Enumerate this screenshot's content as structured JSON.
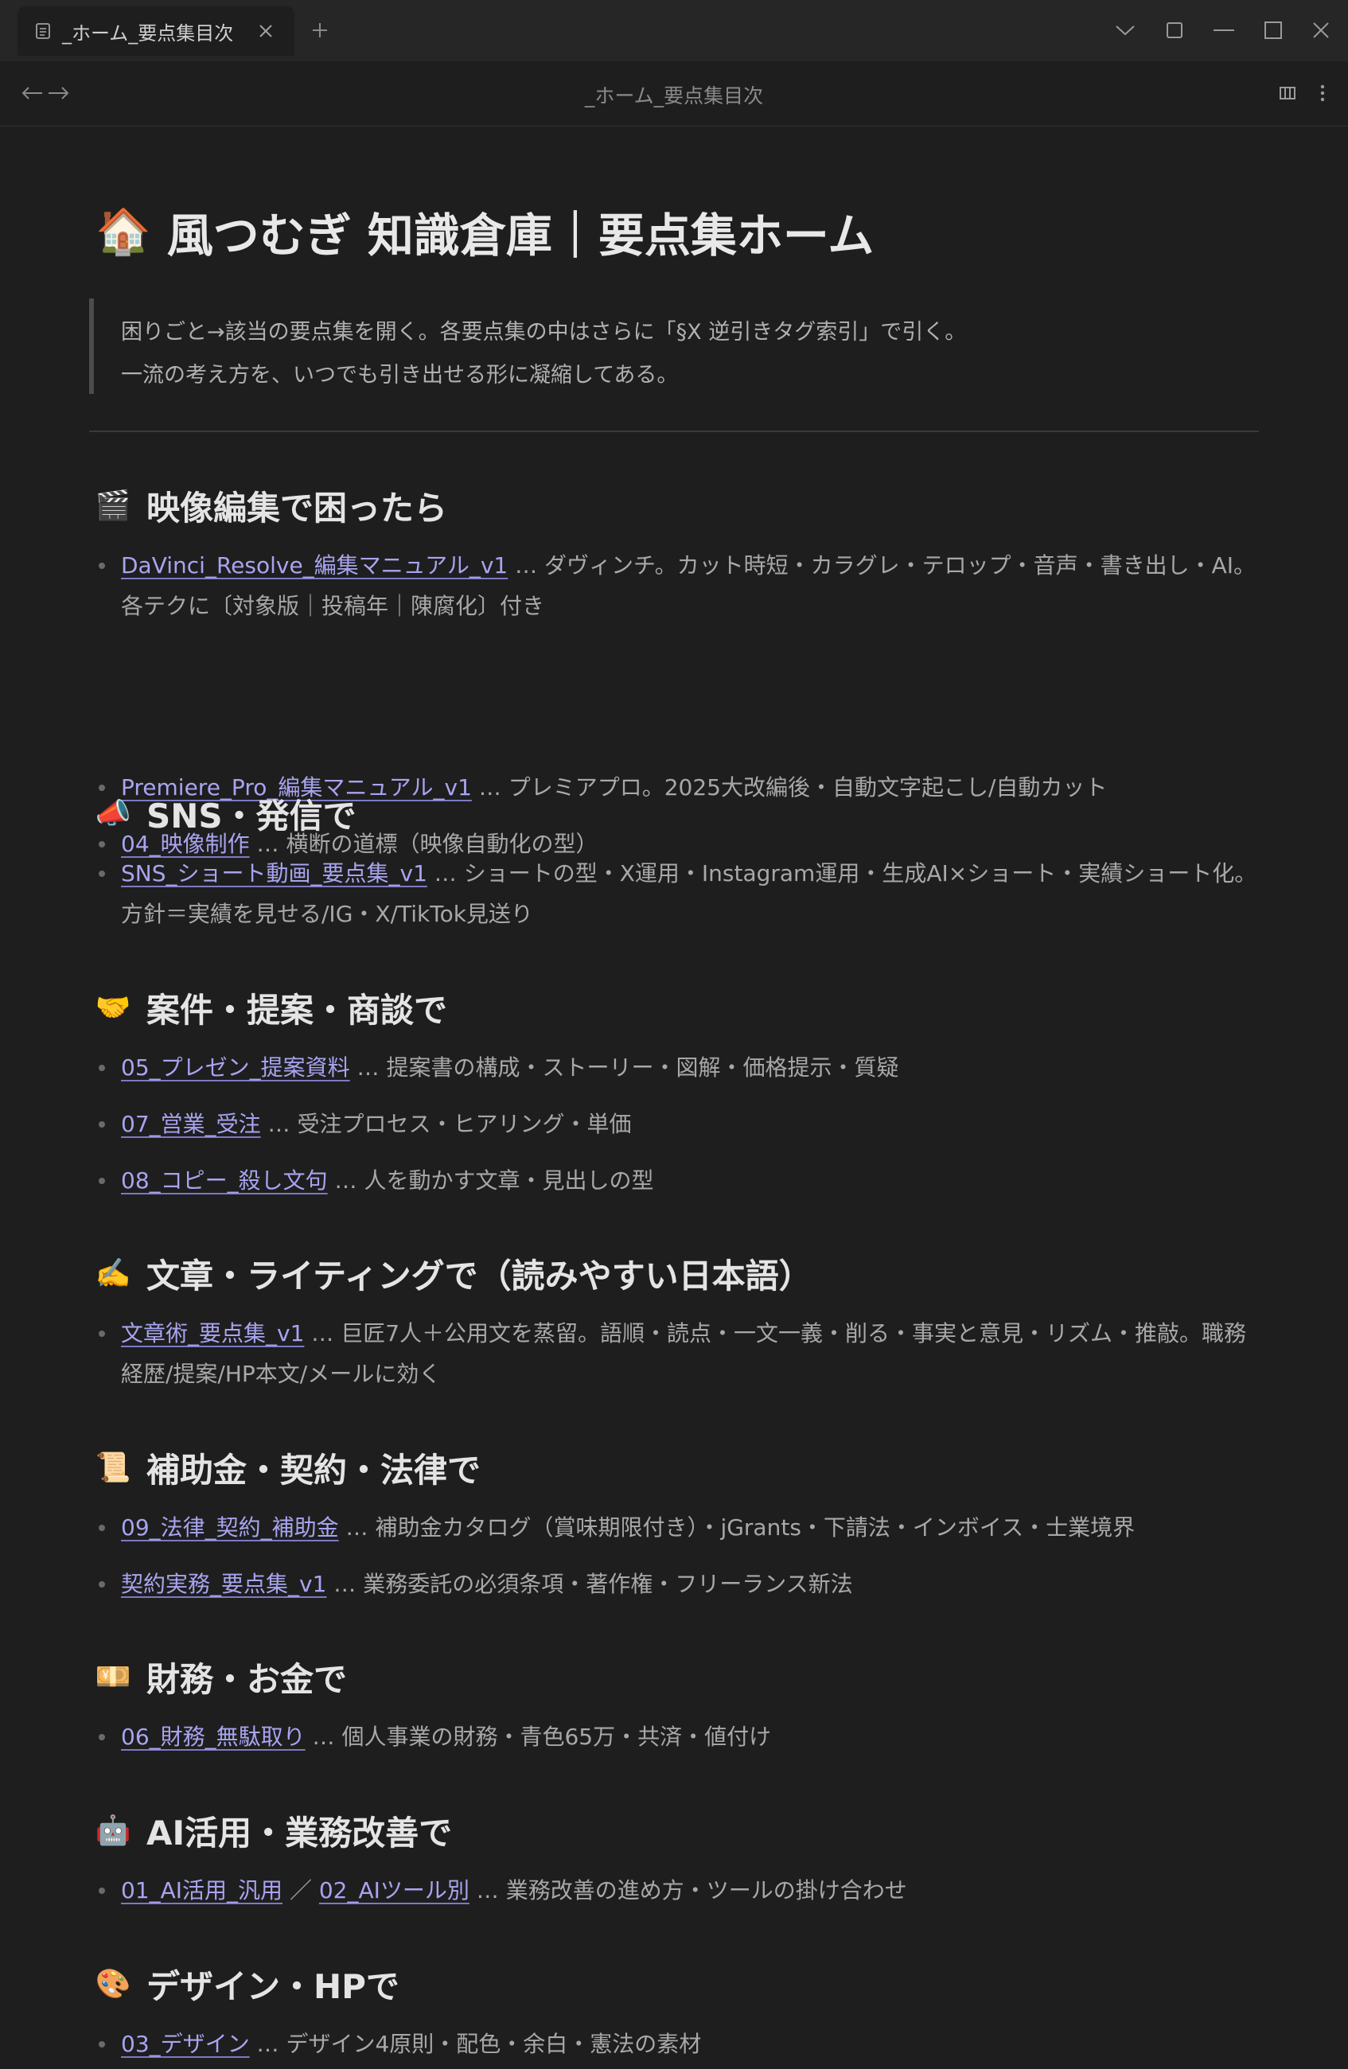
{
  "tab": {
    "title": "_ホーム_要点集目次",
    "icon": "document-icon"
  },
  "header": {
    "title": "_ホーム_要点集目次"
  },
  "page": {
    "title_emoji": "🏠",
    "title": "風つむぎ 知識倉庫｜要点集ホーム",
    "quote_line1": "困りごと→該当の要点集を開く。各要点集の中はさらに「§X 逆引きタグ索引」で引く。",
    "quote_line2": "一流の考え方を、いつでも引き出せる形に凝縮してある。"
  },
  "sections": [
    {
      "emoji": "🎬",
      "heading": "映像編集で困ったら",
      "items": [
        {
          "link": "DaVinci_Resolve_編集マニュアル_v1",
          "desc": " … ダヴィンチ。カット時短・カラグレ・テロップ・音声・書き出し・AI。各テクに〔対象版｜投稿年｜陳腐化〕付き"
        },
        {
          "link": "Premiere_Pro_編集マニュアル_v1",
          "desc": " … プレミアプロ。2025大改編後・自動文字起こし/自動カット"
        },
        {
          "link": "04_映像制作",
          "desc": " … 横断の道標（映像自動化の型）"
        }
      ]
    },
    {
      "emoji": "📣",
      "heading": "SNS・発信で",
      "items": [
        {
          "link": "SNS_ショート動画_要点集_v1",
          "desc": " … ショートの型・X運用・Instagram運用・生成AI×ショート・実績ショート化。方針＝実績を見せる/IG・X/TikTok見送り"
        }
      ]
    },
    {
      "emoji": "🤝",
      "heading": "案件・提案・商談で",
      "items": [
        {
          "link": "05_プレゼン_提案資料",
          "desc": " … 提案書の構成・ストーリー・図解・価格提示・質疑"
        },
        {
          "link": "07_営業_受注",
          "desc": " … 受注プロセス・ヒアリング・単価"
        },
        {
          "link": "08_コピー_殺し文句",
          "desc": " … 人を動かす文章・見出しの型"
        }
      ]
    },
    {
      "emoji": "✍️",
      "heading": "文章・ライティングで（読みやすい日本語）",
      "items": [
        {
          "link": "文章術_要点集_v1",
          "desc": " … 巨匠7人＋公用文を蒸留。語順・読点・一文一義・削る・事実と意見・リズム・推敲。職務経歴/提案/HP本文/メールに効く"
        }
      ]
    },
    {
      "emoji": "📜",
      "heading": "補助金・契約・法律で",
      "items": [
        {
          "link": "09_法律_契約_補助金",
          "desc": " … 補助金カタログ（賞味期限付き）・jGrants・下請法・インボイス・士業境界"
        },
        {
          "link": "契約実務_要点集_v1",
          "desc": " … 業務委託の必須条項・著作権・フリーランス新法"
        }
      ]
    },
    {
      "emoji": "💴",
      "heading": "財務・お金で",
      "items": [
        {
          "link": "06_財務_無駄取り",
          "desc": " … 個人事業の財務・青色65万・共済・値付け"
        }
      ]
    },
    {
      "emoji": "🤖",
      "heading": "AI活用・業務改善で",
      "items": [
        {
          "link": "01_AI活用_汎用",
          "sep": " ／ ",
          "link2": "02_AIツール別",
          "desc": " … 業務改善の進め方・ツールの掛け合わせ"
        }
      ]
    },
    {
      "emoji": "🎨",
      "heading": "デザイン・HPで",
      "items": [
        {
          "link": "03_デザイン",
          "desc": " … デザイン4原則・配色・余白・憲法の素材"
        }
      ]
    }
  ]
}
